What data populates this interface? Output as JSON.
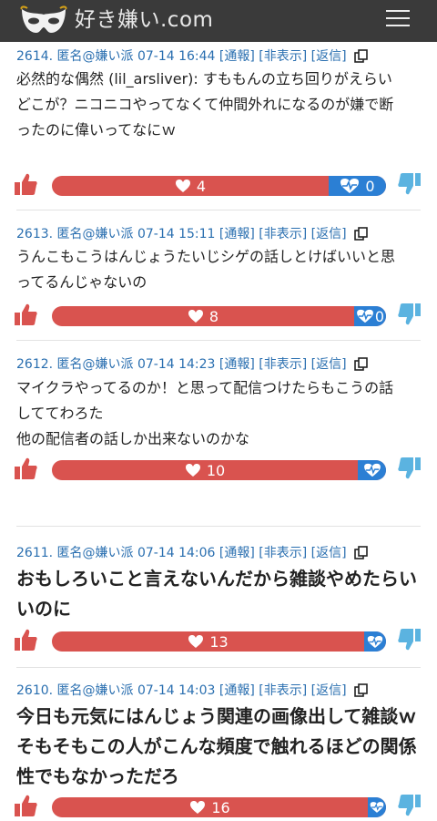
{
  "header": {
    "site_title": "好き嫌い.com",
    "menu_icon": "hamburger-icon",
    "logo_icon": "mask-icon",
    "background": "#3a3a3a"
  },
  "colors": {
    "like": "#d9534f",
    "dislike": "#2b7fd4",
    "meta": "#2a6fb0",
    "thumb_up": "#d9534f",
    "thumb_down": "#5bb3e0"
  },
  "posts": [
    {
      "meta": "2614. 匿名@嫌い派 07-14 16:44 [通報] [非表示] [返信]",
      "lines": [
        "必然的な偶然 (lil_arsliver): すももんの立ち回りがえらい",
        "",
        "どこが？ニコニコやってなくて仲間外れになるのが嫌で断",
        "ったのに偉いってなにｗ"
      ],
      "likes": "4",
      "dislikes": "0",
      "like_ratio": 0.83
    },
    {
      "meta": "2613. 匿名@嫌い派 07-14 15:11 [通報] [非表示] [返信]",
      "lines": [
        "うんこもこうはんじょうたいじシゲの話しとけばいいと思",
        "ってるんじゃないの"
      ],
      "likes": "8",
      "dislikes": "0",
      "like_ratio": 0.905
    },
    {
      "meta": "2612. 匿名@嫌い派 07-14 14:23 [通報] [非表示] [返信]",
      "lines": [
        "マイクラやってるのか！と思って配信つけたらもこうの話",
        "しててわろた",
        "他の配信者の話しか出来ないのかな"
      ],
      "likes": "10",
      "dislikes": "",
      "like_ratio": 0.915
    },
    {
      "meta": "2611. 匿名@嫌い派 07-14 14:06 [通報] [非表示] [返信]",
      "lines": [
        "おもしろいこと言えないんだから雑談やめたらい",
        "いのに"
      ],
      "likes": "13",
      "dislikes": "",
      "like_ratio": 0.935
    },
    {
      "meta": "2610. 匿名@嫌い派 07-14 14:03 [通報] [非表示] [返信]",
      "lines": [
        "今日も元気にはんじょう関連の画像出して雑談ｗ",
        "そもそもこの人がこんな頻度で触れるほどの関係",
        "性でもなかっただろ"
      ],
      "likes": "16",
      "dislikes": "",
      "like_ratio": 0.945
    }
  ]
}
